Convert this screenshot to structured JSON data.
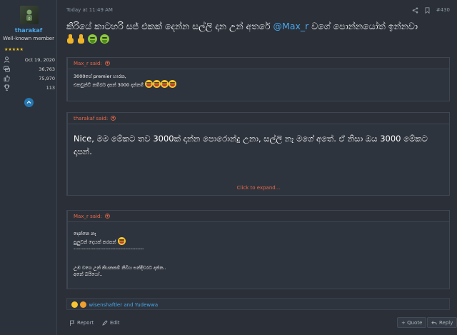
{
  "user": {
    "name": "tharakaf",
    "title": "Well-known member",
    "stars": "★★★★★",
    "stats": [
      {
        "icon": "person-icon",
        "value": "Oct 19, 2020"
      },
      {
        "icon": "messages-icon",
        "value": "36,763"
      },
      {
        "icon": "thumbs-up-icon",
        "value": "75,970"
      },
      {
        "icon": "trophy-icon",
        "value": "113"
      }
    ]
  },
  "post": {
    "date": "Today at 11:49 AM",
    "number": "#430",
    "text_before": "කිරියේ කාටහරි සජ් එකක් දෙන්න සල්ලි දාන උන් අතරේ ",
    "mention": "@Max_r",
    "text_after": " වගේ පොන්නයෝත් ඉන්නවා"
  },
  "quotes": [
    {
      "author": "Max_r said:",
      "lines": [
        "3000ගේ premier භාරක,",
        "එකවුන්ට් නම්බර් දාපන් 3000 දාන්නම්"
      ]
    },
    {
      "author": "tharakaf said:",
      "text": "Nice, මම මේකට තව 3000ක් දාන්න පොරොන්දු උනා, සල්ලි නෑ මගේ අතේ. ඒ නිසා ඔය 3000 මේකට දාපන්.",
      "expand": "Click to expand..."
    },
    {
      "author": "Max_r said:",
      "lines": [
        "දෙන්නෙ නෑ",
        "පුලුවන් දෙයක් කරපන්",
        "------------------------------------------",
        "",
        "",
        "උඹ වගෙ උන් කියනකම් නිවිය සන්දිවරට දාන්න..",
        "අනේ බයියෝ.."
      ]
    }
  ],
  "reactions": {
    "text": "wisenshaftler and Yudewwa"
  },
  "footer": {
    "report": "Report",
    "edit": "Edit",
    "quote": "+ Quote",
    "reply": "Reply"
  }
}
